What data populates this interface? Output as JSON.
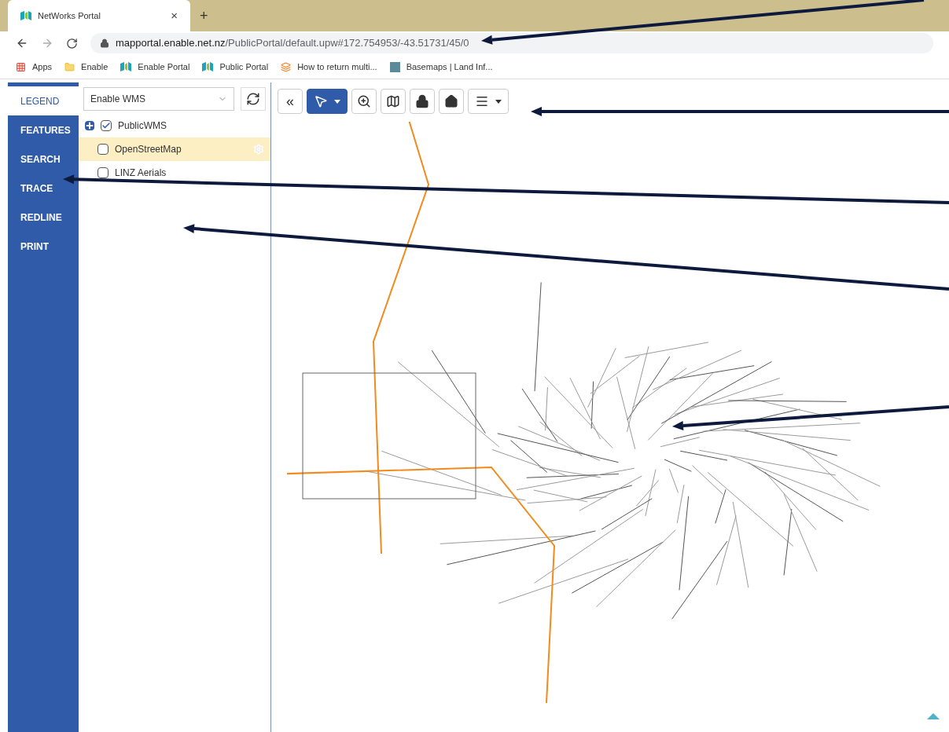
{
  "browser": {
    "tab": {
      "title": "NetWorks Portal",
      "close": "×",
      "new_tab": "+"
    },
    "url": {
      "domain": "mapportal.enable.net.nz",
      "path": "/PublicPortal/default.upw#172.754953/-43.51731/45/0"
    },
    "bookmarks": [
      {
        "kind": "apps",
        "label": "Apps"
      },
      {
        "kind": "folder",
        "label": "Enable"
      },
      {
        "kind": "portal",
        "label": "Enable Portal"
      },
      {
        "kind": "portal",
        "label": "Public Portal"
      },
      {
        "kind": "stack",
        "label": "How to return multi..."
      },
      {
        "kind": "map",
        "label": "Basemaps | Land Inf..."
      }
    ]
  },
  "sidebar": {
    "items": [
      {
        "label": "LEGEND",
        "selected": true
      },
      {
        "label": "FEATURES",
        "selected": false
      },
      {
        "label": "SEARCH",
        "selected": false
      },
      {
        "label": "TRACE",
        "selected": false
      },
      {
        "label": "REDLINE",
        "selected": false
      },
      {
        "label": "PRINT",
        "selected": false
      }
    ]
  },
  "legend": {
    "service": "Enable WMS",
    "layers": [
      {
        "label": "PublicWMS",
        "checked": true,
        "expandable": true,
        "selected": false,
        "children": [
          {
            "label": "OpenStreetMap",
            "checked": false,
            "expandable": false,
            "selected": true
          },
          {
            "label": "LINZ Aerials",
            "checked": false,
            "expandable": false,
            "selected": false
          }
        ]
      }
    ]
  },
  "toolbar": [
    {
      "kind": "collapse",
      "text": "«",
      "selected": false
    },
    {
      "kind": "select",
      "selected": true
    },
    {
      "kind": "zoom-box",
      "selected": false
    },
    {
      "kind": "map-refresh",
      "selected": false
    },
    {
      "kind": "lock",
      "selected": false
    },
    {
      "kind": "home",
      "selected": false
    },
    {
      "kind": "menu",
      "selected": false
    }
  ]
}
